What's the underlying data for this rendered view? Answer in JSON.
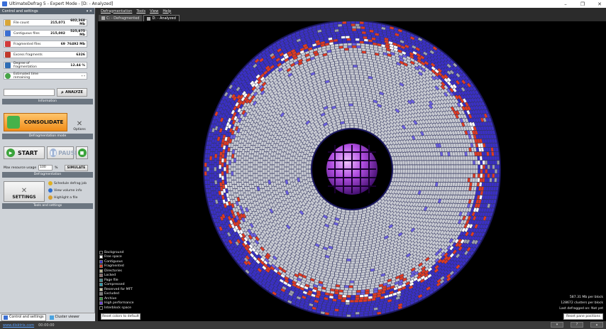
{
  "window": {
    "title": "UltimateDefrag 5 - Expert Mode - [D: - Analyzed]",
    "controls": [
      "–",
      "❐",
      "✕"
    ]
  },
  "left_panel": {
    "header": "Control and settings",
    "pin": "▾ ✕",
    "stats": [
      {
        "label": "File count",
        "v1": "215,071",
        "v2": "602,368 Mb",
        "color": "#d8a637"
      },
      {
        "label": "Contiguous files",
        "v1": "215,002",
        "v2": "525,875 Mb",
        "color": "#3b6fd1"
      },
      {
        "label": "Fragmented files",
        "v1": "69",
        "v2": "76492 Mb",
        "color": "#d23b3b"
      },
      {
        "label": "Excess fragments",
        "v1": "",
        "v2": "6326",
        "color": "#c0392b"
      },
      {
        "label": "Degree of fragmentation",
        "v1": "",
        "v2": "12.44 %",
        "color": "#2e6db5"
      },
      {
        "label": "Estimated time remaining",
        "v1": "",
        "v2": "- -",
        "color": "#47a447"
      }
    ],
    "analyze_label": "ANALYZE",
    "information_caption": "Information",
    "consolidate_label": "CONSOLIDATE",
    "options_label": "Options",
    "defrag_mode_caption": "Defragmentation mode",
    "start_label": "START",
    "pause_label": "PAUSE",
    "max_resource_label": "Max resource usage",
    "max_resource_value": "100",
    "percent_sign": "%",
    "simulate_label": "SIMULATE",
    "defragmentation_caption": "Defragmentation",
    "settings_label": "SETTINGS",
    "tool_links": [
      "Schedule defrag job",
      "View volume info",
      "Highlight a file"
    ],
    "tools_caption": "Tools and settings",
    "bottom_tabs": [
      "Control and settings",
      "Cluster viewer"
    ]
  },
  "menu": [
    "Defragmentation",
    "Tools",
    "View",
    "Help"
  ],
  "drive_tabs": [
    {
      "label": "C: - Defragmented",
      "active": false
    },
    {
      "label": "D: - Analyzed",
      "active": true
    }
  ],
  "legend": [
    {
      "label": "Background",
      "color": "#000000"
    },
    {
      "label": "Free space",
      "color": "#ffffff"
    },
    {
      "label": "Contiguous",
      "color": "#3a2fc6"
    },
    {
      "label": "Fragmented",
      "color": "#e03a22"
    },
    {
      "label": "Directories",
      "color": "#b8b38a"
    },
    {
      "label": "Locked",
      "color": "#8a6a6a"
    },
    {
      "label": "Page file",
      "color": "#3a8a8a"
    },
    {
      "label": "Compressed",
      "color": "#1e9bb0"
    },
    {
      "label": "Reserved for MFT",
      "color": "#c8c8a0"
    },
    {
      "label": "Excluded",
      "color": "#7a7a7a"
    },
    {
      "label": "Archive",
      "color": "#2f8f3a"
    },
    {
      "label": "High performance",
      "color": "#6a3ad8"
    },
    {
      "label": "Interblock space",
      "color": "#000000"
    }
  ],
  "reset_colors_label": "Reset colors to default",
  "info_lines": [
    "587.31 Mb per block",
    "128672 clusters per block",
    "Last defragged on: Not yet"
  ],
  "reset_pane_label": "Reset pane positions",
  "status": {
    "website": "www.disktrix.com",
    "time": "00:00:00"
  }
}
